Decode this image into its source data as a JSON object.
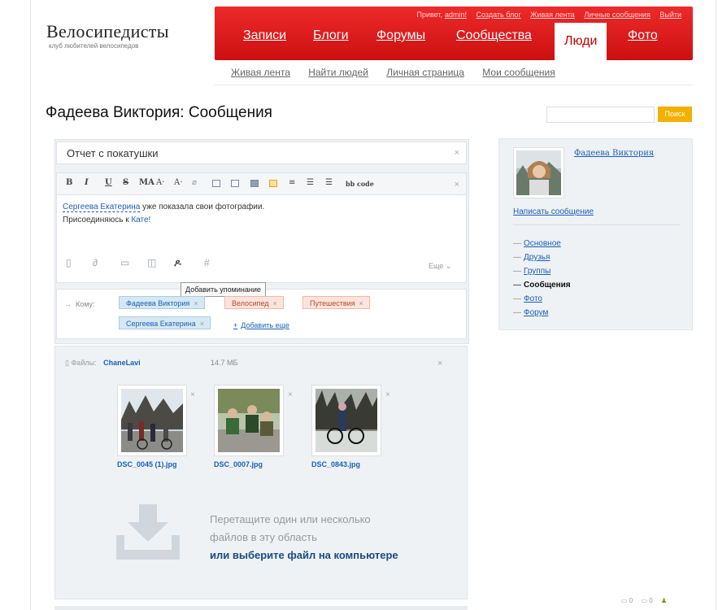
{
  "logo": {
    "title": "Велосипедисты",
    "subtitle": "клуб любителей велосипедов"
  },
  "top_links": {
    "greeting": "Привет,",
    "user": "admin!",
    "items": [
      "Создать блог",
      "Живая лента",
      "Личные сообщения",
      "Выйти"
    ]
  },
  "nav": {
    "items": [
      "Записи",
      "Блоги",
      "Форумы",
      "Сообщества",
      "Люди",
      "Фото"
    ],
    "active": "Люди"
  },
  "subnav": {
    "items": [
      "Живая лента",
      "Найти людей",
      "Личная страница",
      "Мои сообщения"
    ]
  },
  "page_title": "Фадеева Виктория: Сообщения",
  "search": {
    "button": "Поиск",
    "value": ""
  },
  "editor": {
    "subject": "Отчет с покатушки",
    "toolbar": [
      "B",
      "I",
      "U",
      "S",
      "MA",
      "A·",
      "A·",
      "bb code"
    ],
    "body_mention": "Сергеева Екатерина",
    "body_line1_rest": " уже показала свои фотографии.",
    "body_line2_prefix": "Присоединяюсь к ",
    "body_line2_link": "Кате!",
    "more": "Еще ⌄",
    "tooltip": "Добавить упоминание"
  },
  "recipients": {
    "label": "Кому:",
    "chips": [
      {
        "name": "Фадеева Виктория",
        "color": "blue"
      },
      {
        "name": "Велосипед",
        "color": "red"
      },
      {
        "name": "Путешествия",
        "color": "red"
      },
      {
        "name": "Сергеева Екатерина",
        "color": "blue"
      }
    ],
    "add_more": "Добавить еще"
  },
  "files": {
    "label": "Файлы:",
    "owner": "ChaneLavi",
    "size": "14.7 МБ",
    "items": [
      {
        "name": "DSC_0045 (1).jpg"
      },
      {
        "name": "DSC_0007.jpg"
      },
      {
        "name": "DSC_0843.jpg"
      }
    ],
    "drop_line1": "Перетащите один или несколько",
    "drop_line2": "файлов в эту область",
    "drop_link": "или выберите файл на компьютере"
  },
  "sidebar": {
    "profile_name": "Фадеева Виктория",
    "write_message": "Написать сообщение",
    "menu": [
      {
        "label": "Основное",
        "current": false
      },
      {
        "label": "Друзья",
        "current": false
      },
      {
        "label": "Группы",
        "current": false
      },
      {
        "label": "Сообщения",
        "current": true
      },
      {
        "label": "Фото",
        "current": false
      },
      {
        "label": "Форум",
        "current": false
      }
    ]
  },
  "bottom_bar": {
    "c1": "0",
    "c2": "0"
  },
  "colors": {
    "header_red": "#dd1a1a",
    "link_blue": "#1a5fb4",
    "search_orange": "#f3b000"
  }
}
